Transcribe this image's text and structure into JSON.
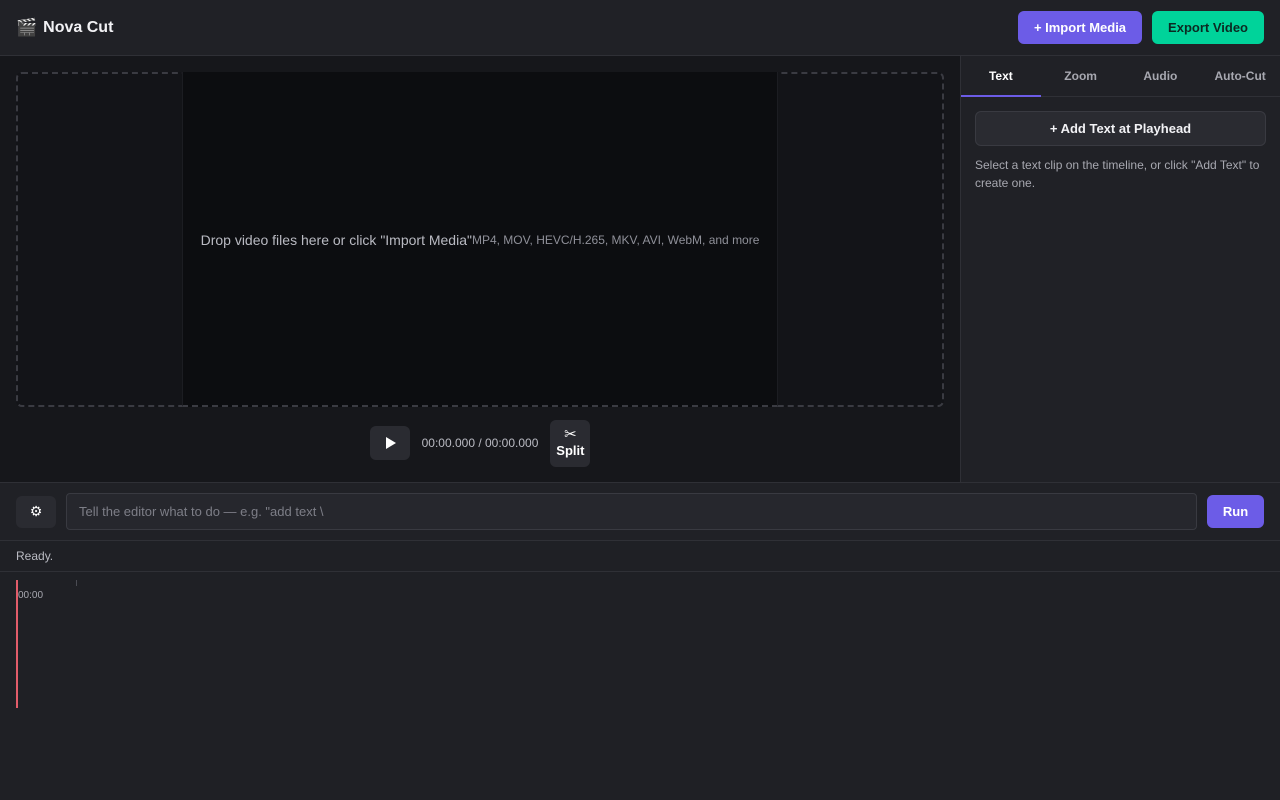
{
  "header": {
    "app_icon": "clapperboard-icon",
    "title": "Nova Cut",
    "import_label": "+ Import Media",
    "export_label": "Export Video",
    "colors": {
      "accent": "#6c5ce7",
      "export": "#00d39a"
    }
  },
  "preview": {
    "drop_text": "Drop video files here or click \"Import Media\"",
    "formats_text": "MP4, MOV, HEVC/H.265, MKV, AVI, WebM, and more",
    "timecode": "00:00.000 / 00:00.000",
    "play_icon": "play-icon",
    "split_icon": "scissors-icon",
    "split_label": "Split"
  },
  "side_panel": {
    "tabs": [
      {
        "label": "Text",
        "active": true
      },
      {
        "label": "Zoom",
        "active": false
      },
      {
        "label": "Audio",
        "active": false
      },
      {
        "label": "Auto-Cut",
        "active": false
      }
    ],
    "add_text_label": "+ Add Text at Playhead",
    "hint": "Select a text clip on the timeline, or click \"Add Text\" to create one."
  },
  "command_bar": {
    "settings_icon": "gear-icon",
    "placeholder": "Tell the editor what to do — e.g. \"add text \\",
    "value": "",
    "run_label": "Run"
  },
  "status": {
    "text": "Ready."
  },
  "timeline": {
    "ruler_labels": [
      "00:00"
    ],
    "playhead_color": "#e25c6a"
  }
}
